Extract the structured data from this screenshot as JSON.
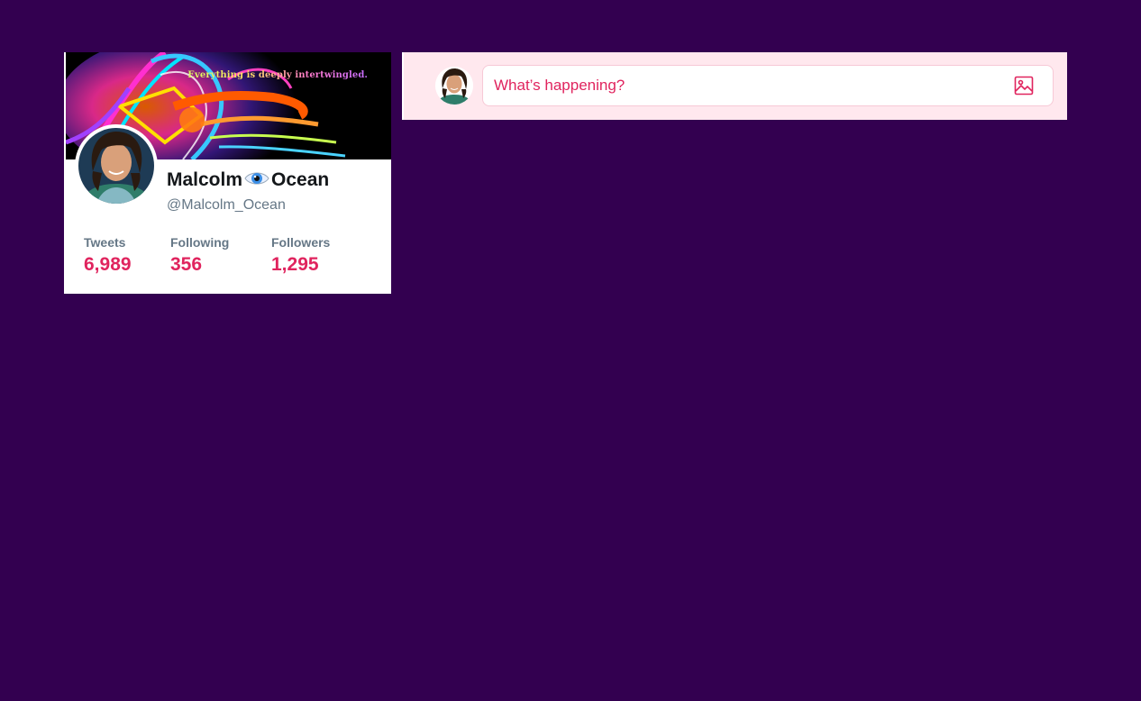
{
  "profile": {
    "banner_caption": "Everything is deeply intertwingled.",
    "name_first": "Malcolm",
    "name_emoji": "eye-icon",
    "name_last": "Ocean",
    "handle": "@Malcolm_Ocean",
    "stats": [
      {
        "label": "Tweets",
        "value": "6,989"
      },
      {
        "label": "Following",
        "value": "356"
      },
      {
        "label": "Followers",
        "value": "1,295"
      }
    ]
  },
  "compose": {
    "placeholder": "What’s happening?",
    "media_icon": "image-icon"
  },
  "colors": {
    "background": "#330050",
    "accent": "#e0245e",
    "secondary_text": "#657786",
    "compose_bg": "#ffe8ee"
  }
}
